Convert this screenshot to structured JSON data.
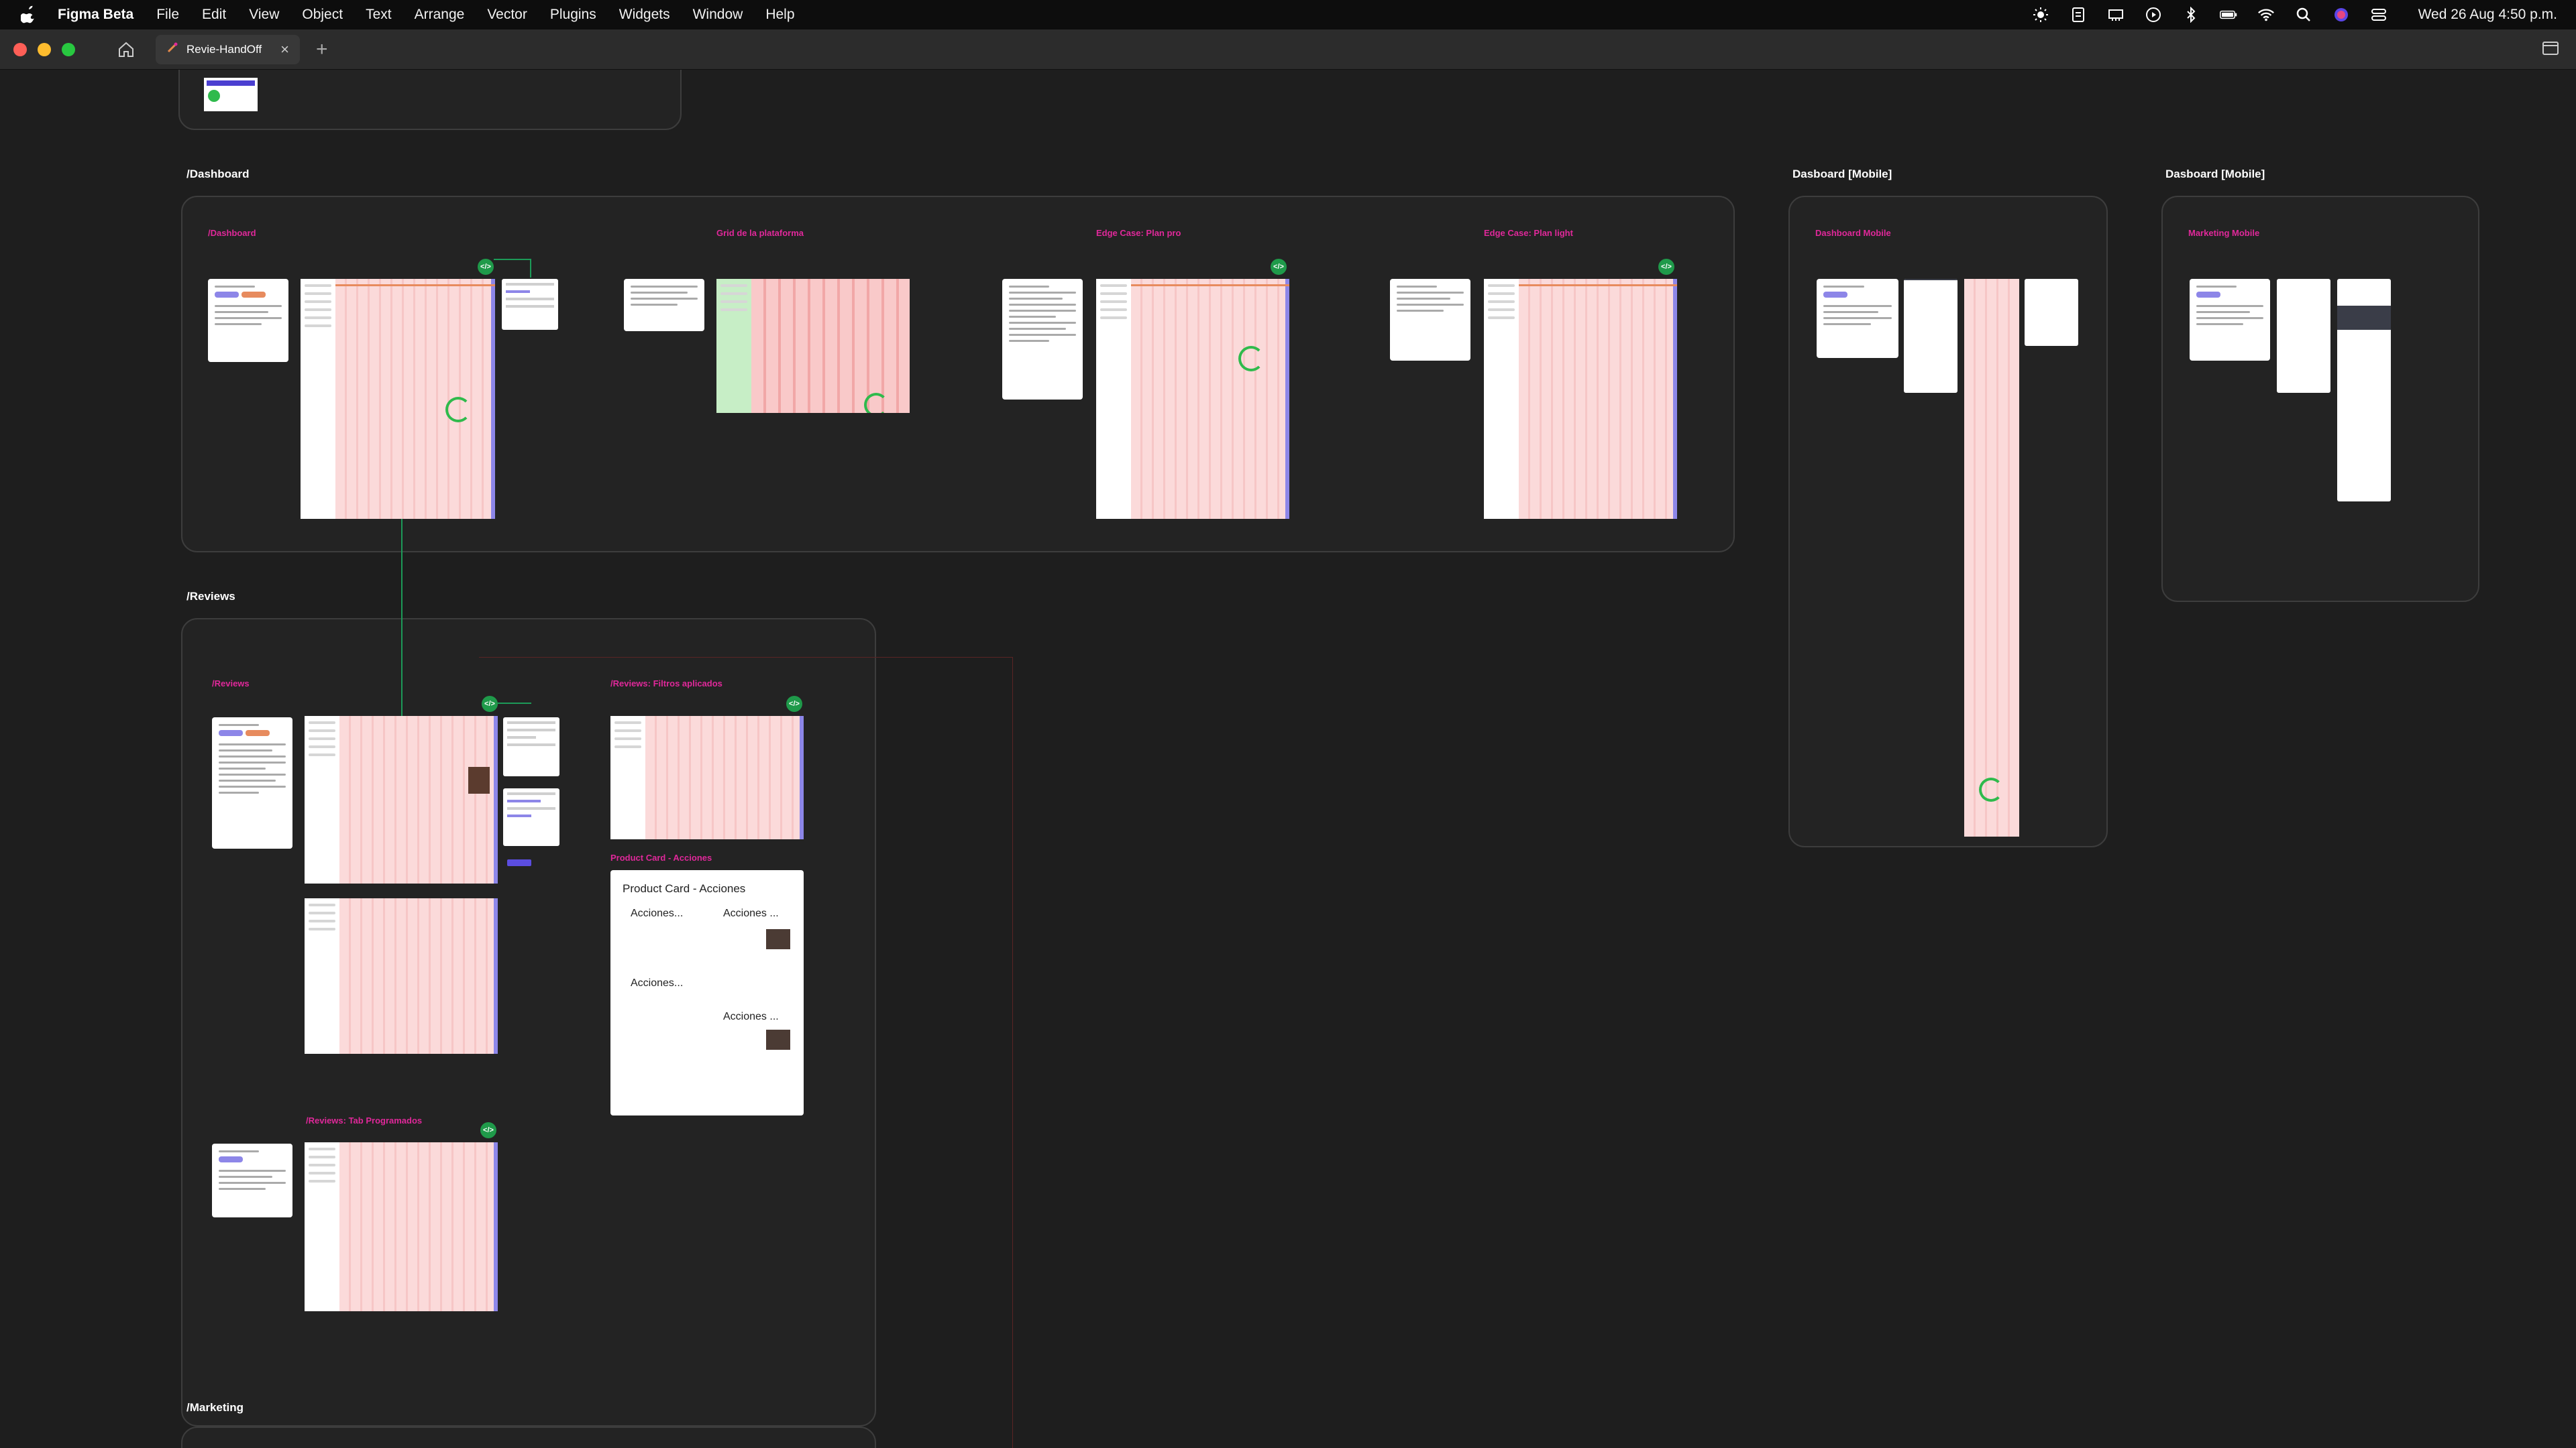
{
  "menubar": {
    "app_name": "Figma Beta",
    "menus": [
      "File",
      "Edit",
      "View",
      "Object",
      "Text",
      "Arrange",
      "Vector",
      "Plugins",
      "Widgets",
      "Window",
      "Help"
    ],
    "clock": "Wed 26 Aug  4:50 p.m."
  },
  "tabbar": {
    "tab_title": "Revie-HandOff",
    "new_tab": "+"
  },
  "canvas": {
    "sections": {
      "dashboard": "/Dashboard",
      "dashboard_mobile_1": "Dasboard [Mobile]",
      "dashboard_mobile_2": "Dasboard [Mobile]",
      "reviews": "/Reviews",
      "marketing": "/Marketing"
    },
    "frames": {
      "dashboard": "/Dashboard",
      "grid": "Grid de la plataforma",
      "edge_pro": "Edge Case: Plan pro",
      "edge_light": "Edge Case: Plan light",
      "dashboard_mobile": "Dashboard Mobile",
      "marketing_mobile": "Marketing Mobile",
      "reviews": "/Reviews",
      "reviews_filters": "/Reviews: Filtros aplicados",
      "product_card": "Product Card - Acciones",
      "reviews_tab": "/Reviews: Tab Programados"
    },
    "product_card": {
      "title": "Product Card - Acciones",
      "items": [
        "Acciones...",
        "Acciones ...",
        "Acciones...",
        "Acciones ..."
      ]
    },
    "code_badge": "</>"
  },
  "colors": {
    "accent_label": "#e0289a",
    "connector": "#1c9a58",
    "screen_bg": "#fbe3e3",
    "ring": "#2fba4c"
  }
}
